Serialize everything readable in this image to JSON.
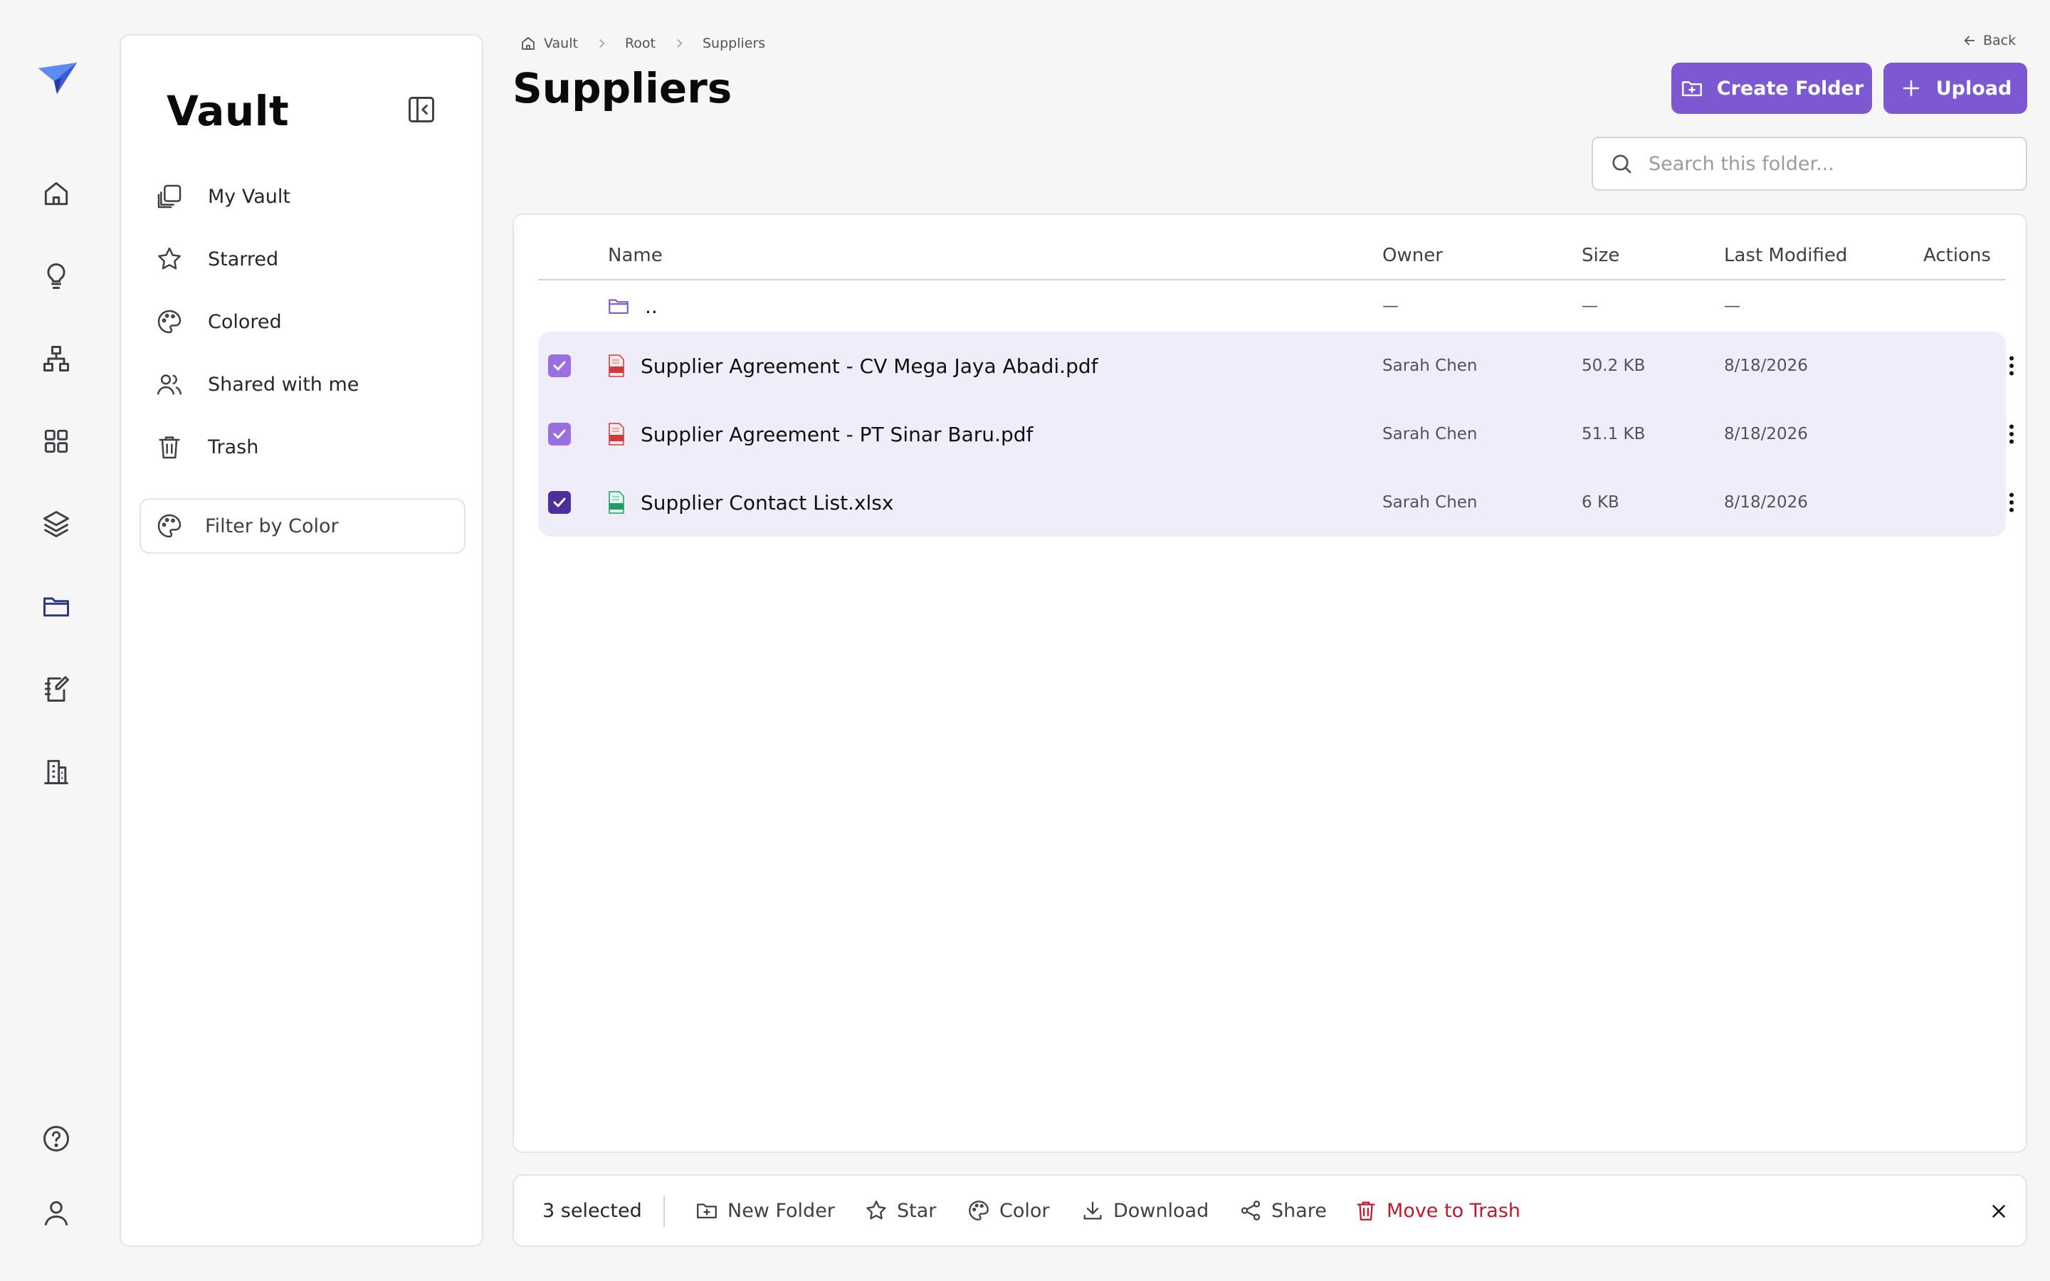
{
  "sidebar": {
    "title": "Vault",
    "items": [
      {
        "label": "My Vault",
        "icon": "copy-icon"
      },
      {
        "label": "Starred",
        "icon": "star-icon"
      },
      {
        "label": "Colored",
        "icon": "palette-icon"
      },
      {
        "label": "Shared with me",
        "icon": "users-icon"
      },
      {
        "label": "Trash",
        "icon": "trash-icon"
      }
    ],
    "filter_label": "Filter by Color"
  },
  "breadcrumb": [
    "Vault",
    "Root",
    "Suppliers"
  ],
  "back_label": "Back",
  "page_title": "Suppliers",
  "buttons": {
    "create_folder": "Create Folder",
    "upload": "Upload"
  },
  "search": {
    "placeholder": "Search this folder...",
    "value": ""
  },
  "table": {
    "columns": [
      "Name",
      "Owner",
      "Size",
      "Last Modified",
      "Actions"
    ],
    "parent_row": {
      "name": "..",
      "owner": "—",
      "size": "—",
      "modified": "—"
    },
    "rows": [
      {
        "name": "Supplier Agreement - CV Mega Jaya Abadi.pdf",
        "type": "pdf",
        "owner": "Sarah Chen",
        "size": "50.2 KB",
        "modified": "8/18/2026",
        "checked": true
      },
      {
        "name": "Supplier Agreement - PT Sinar Baru.pdf",
        "type": "pdf",
        "owner": "Sarah Chen",
        "size": "51.1 KB",
        "modified": "8/18/2026",
        "checked": true
      },
      {
        "name": "Supplier Contact List.xlsx",
        "type": "xlsx",
        "owner": "Sarah Chen",
        "size": "6 KB",
        "modified": "8/18/2026",
        "checked": true
      }
    ]
  },
  "actionbar": {
    "count_label": "3 selected",
    "new_folder": "New Folder",
    "star": "Star",
    "color": "Color",
    "download": "Download",
    "share": "Share",
    "trash": "Move to Trash"
  },
  "colors": {
    "accent": "#7c58d3",
    "selected_row": "#efedf9",
    "danger": "#c0192e",
    "pdf": "#d23a3a",
    "xlsx": "#1e9e62"
  }
}
